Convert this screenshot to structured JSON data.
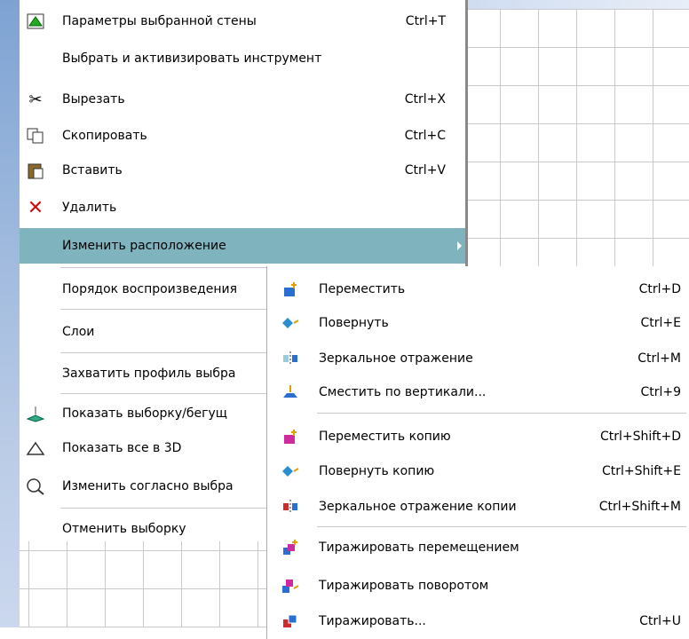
{
  "main_menu": {
    "items": [
      {
        "label": "Параметры выбранной стены",
        "shortcut": "Ctrl+T",
        "icon": "wall-params-icon"
      },
      {
        "label": "Выбрать и активизировать инструмент",
        "shortcut": "",
        "icon": ""
      },
      {
        "label": "Вырезать",
        "shortcut": "Ctrl+X",
        "icon": "scissors-icon"
      },
      {
        "label": "Скопировать",
        "shortcut": "Ctrl+C",
        "icon": "copy-icon"
      },
      {
        "label": "Вставить",
        "shortcut": "Ctrl+V",
        "icon": "paste-icon"
      },
      {
        "label": "Удалить",
        "shortcut": "",
        "icon": "delete-icon"
      },
      {
        "label": "Изменить расположение",
        "shortcut": "",
        "icon": ""
      },
      {
        "label": "Порядок воспроизведения",
        "shortcut": "",
        "icon": ""
      },
      {
        "label": "Слои",
        "shortcut": "",
        "icon": ""
      },
      {
        "label": "Захватить профиль выбра",
        "shortcut": "",
        "icon": ""
      },
      {
        "label": "Показать выборку/бегущ",
        "shortcut": "",
        "icon": "show-selection-icon"
      },
      {
        "label": "Показать все в 3D",
        "shortcut": "",
        "icon": "show-3d-icon"
      },
      {
        "label": "Изменить согласно выбра",
        "shortcut": "",
        "icon": "modify-selection-icon"
      },
      {
        "label": "Отменить выборку",
        "shortcut": "",
        "icon": ""
      }
    ]
  },
  "sub_menu": {
    "items": [
      {
        "label": "Переместить",
        "shortcut": "Ctrl+D",
        "icon": "move-icon"
      },
      {
        "label": "Повернуть",
        "shortcut": "Ctrl+E",
        "icon": "rotate-icon"
      },
      {
        "label": "Зеркальное отражение",
        "shortcut": "Ctrl+M",
        "icon": "mirror-icon"
      },
      {
        "label": "Сместить по вертикали...",
        "shortcut": "Ctrl+9",
        "icon": "elevate-icon"
      },
      {
        "label": "Переместить копию",
        "shortcut": "Ctrl+Shift+D",
        "icon": "move-copy-icon"
      },
      {
        "label": "Повернуть копию",
        "shortcut": "Ctrl+Shift+E",
        "icon": "rotate-copy-icon"
      },
      {
        "label": "Зеркальное отражение копии",
        "shortcut": "Ctrl+Shift+M",
        "icon": "mirror-copy-icon"
      },
      {
        "label": "Тиражировать перемещением",
        "shortcut": "",
        "icon": "multiply-move-icon"
      },
      {
        "label": "Тиражировать поворотом",
        "shortcut": "",
        "icon": "multiply-rotate-icon"
      },
      {
        "label": "Тиражировать...",
        "shortcut": "Ctrl+U",
        "icon": "multiply-icon"
      }
    ]
  },
  "colors": {
    "highlight": "#7fb3bd",
    "delete_icon": "#d01010"
  }
}
